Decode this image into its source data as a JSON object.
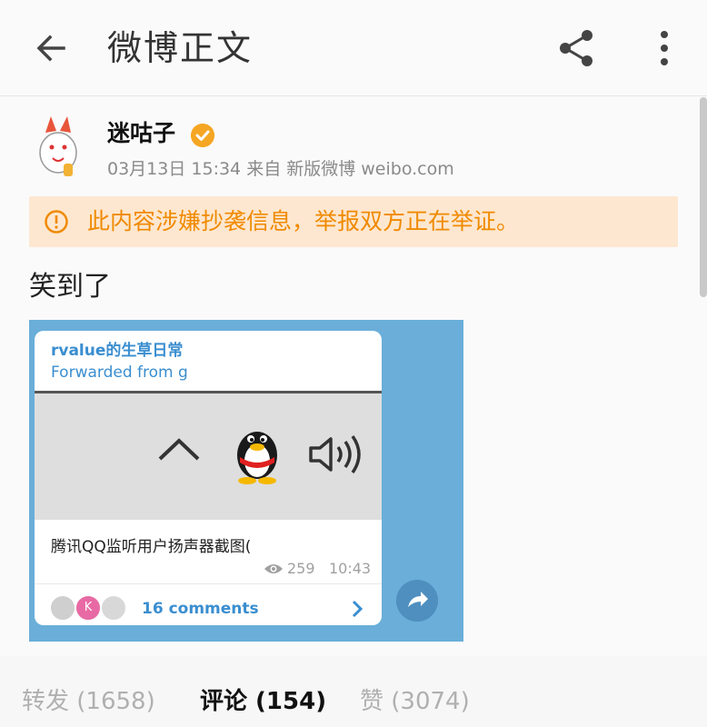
{
  "appbar": {
    "title": "微博正文",
    "back_icon": "arrow-left-icon",
    "share_icon": "share-icon",
    "more_icon": "more-vertical-icon"
  },
  "post": {
    "username": "迷咕子",
    "verified_icon": "verified-badge-icon",
    "meta": "03月13日 15:34  来自 新版微博 weibo.com",
    "warning": "此内容涉嫌抄袭信息，举报双方正在举证。",
    "text": "笑到了"
  },
  "image": {
    "channel": "rvalue的生草日常",
    "forwarded": "Forwarded from g",
    "caption": "腾讯QQ监听用户扬声器截图(",
    "views": "259",
    "time": "10:43",
    "avatar_letter": "K",
    "comments": "16 comments"
  },
  "tabs": {
    "repost": "转发 (1658)",
    "comment": "评论 (154)",
    "like": "赞 (3074)"
  },
  "colors": {
    "warning_bg": "#fde7d0",
    "warning_text": "#f08a00",
    "telegram_blue": "#3a8ed0",
    "verified": "#f5a623"
  }
}
